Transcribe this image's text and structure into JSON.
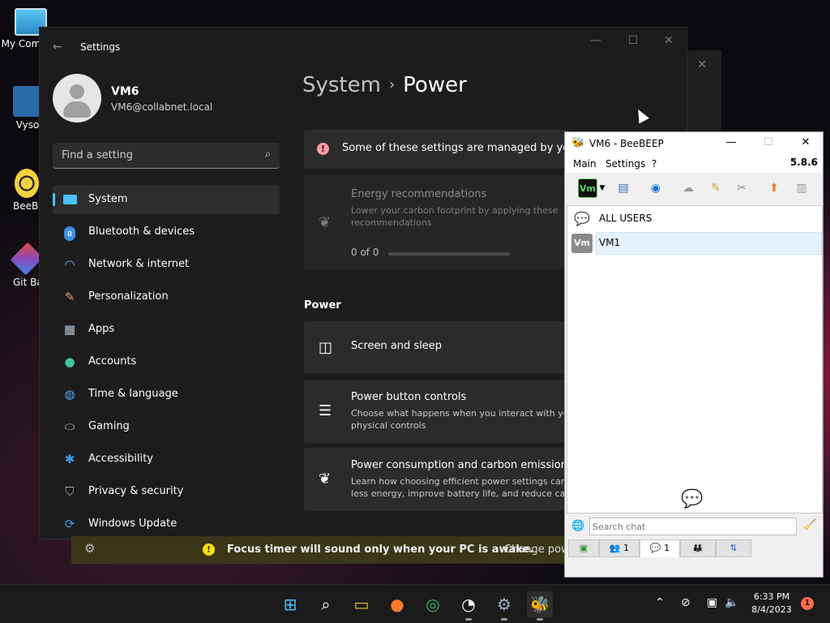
{
  "desktop": {
    "icons": [
      {
        "label": "My Com",
        "icon": "monitor-icon"
      },
      {
        "label": "Vyso",
        "icon": "vysor-icon"
      },
      {
        "label": "BeeBE",
        "icon": "beebeep-icon"
      },
      {
        "label": "Git Ba",
        "icon": "git-bash-icon"
      }
    ]
  },
  "settings": {
    "window_title": "Settings",
    "user": {
      "name": "VM6",
      "email": "VM6@collabnet.local"
    },
    "search_placeholder": "Find a setting",
    "nav": [
      {
        "label": "System",
        "icon": "monitor-icon",
        "color": "#4cc2ff",
        "active": true
      },
      {
        "label": "Bluetooth & devices",
        "icon": "bluetooth-icon",
        "color": "#3a8fe6"
      },
      {
        "label": "Network & internet",
        "icon": "wifi-icon",
        "color": "#5ac8fa"
      },
      {
        "label": "Personalization",
        "icon": "brush-icon",
        "color": "#e8a25a"
      },
      {
        "label": "Apps",
        "icon": "apps-icon",
        "color": "#b7c7d8"
      },
      {
        "label": "Accounts",
        "icon": "person-icon",
        "color": "#3ac6a0"
      },
      {
        "label": "Time & language",
        "icon": "globe-clock-icon",
        "color": "#4aa8e8"
      },
      {
        "label": "Gaming",
        "icon": "gamepad-icon",
        "color": "#c0c0c0"
      },
      {
        "label": "Accessibility",
        "icon": "accessibility-icon",
        "color": "#3a9ae8"
      },
      {
        "label": "Privacy & security",
        "icon": "shield-icon",
        "color": "#a9a9a9"
      },
      {
        "label": "Windows Update",
        "icon": "update-icon",
        "color": "#3a9ae8"
      }
    ],
    "breadcrumb": {
      "parent": "System",
      "current": "Power"
    },
    "managed_banner": "Some of these settings are managed by your",
    "energy": {
      "title": "Energy recommendations",
      "subtitle_line1": "Lower your carbon footprint by applying these",
      "subtitle_line2": "recommendations",
      "progress": "0 of 0",
      "progress_fraction": 0
    },
    "section_label": "Power",
    "rows": {
      "screen_sleep": {
        "title": "Screen and sleep"
      },
      "power_button": {
        "title": "Power button controls",
        "sub1": "Choose what happens when you interact with yo",
        "sub2": "physical controls"
      },
      "power_consumption": {
        "title": "Power consumption and carbon emissions",
        "sub1": "Learn how choosing efficient power settings can",
        "sub2": "less energy, improve battery life, and reduce carb"
      }
    }
  },
  "focus_banner": {
    "text": "Focus timer will sound only when your PC is awake.",
    "link": "Change pow"
  },
  "beebeep": {
    "title": "VM6 - BeeBEEP",
    "menu": [
      "Main",
      "Settings",
      "?"
    ],
    "version": "5.8.6",
    "status_badge": "Vm",
    "users": [
      {
        "label": "ALL USERS"
      },
      {
        "label": "VM1",
        "badge": "Vm"
      }
    ],
    "search_placeholder": "Search chat",
    "tabs": [
      {
        "count": ""
      },
      {
        "count": "1"
      },
      {
        "count": "1"
      },
      {
        "count": ""
      },
      {
        "count": ""
      }
    ]
  },
  "taskbar": {
    "time": "6:33 PM",
    "date": "8/4/2023",
    "notifications": "1"
  }
}
